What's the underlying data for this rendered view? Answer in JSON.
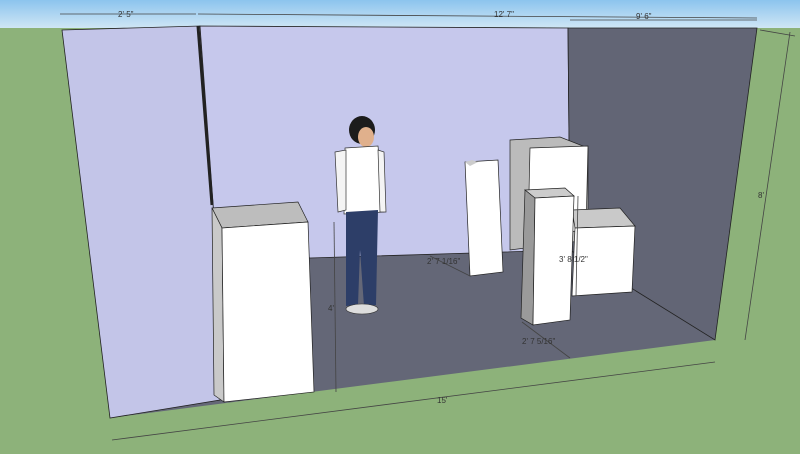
{
  "scene": {
    "colors": {
      "sky": "#a9d3f2",
      "ground": "#8db27a",
      "left_wall": "#c3c5e8",
      "back_wall": "#c6c8ec",
      "right_wall": "#626575",
      "floor": "#646777",
      "box_face": "#ffffff",
      "box_side": "#bdbdbd"
    },
    "dimensions": {
      "top_left": "2' 5\"",
      "top_total": "12' 7\"",
      "top_right": "9' 6\"",
      "right_height": "8'",
      "cabinet_height": "4'",
      "floor_length": "15'",
      "tall_box_width": "2' 7 1/16\"",
      "box_height": "3' 8 1/2\"",
      "front_box_width": "2' 7 5/16\""
    }
  }
}
